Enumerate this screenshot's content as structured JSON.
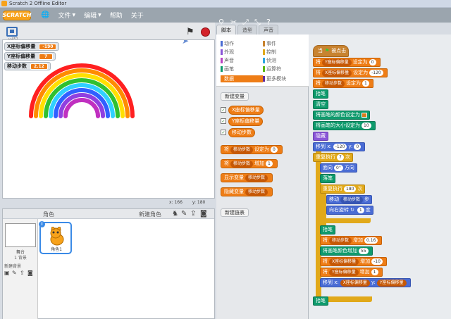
{
  "window": {
    "title": "Scratch 2 Offline Editor"
  },
  "menubar": {
    "logo": "SCRATCH",
    "items": [
      "文件",
      "编辑",
      "帮助",
      "关于"
    ]
  },
  "stage": {
    "monitors": [
      {
        "label": "X座标偏移量",
        "value": "-190"
      },
      {
        "label": "Y座标偏移量",
        "value": "7"
      },
      {
        "label": "移动步数",
        "value": "2.12"
      }
    ],
    "version": "v.452",
    "coords": {
      "x": "x: 166",
      "y": "y: 180"
    },
    "rainbow_colors": [
      "#ff2020",
      "#ff8c00",
      "#ffe000",
      "#30c030",
      "#30d0ff",
      "#3060ff",
      "#9040e0",
      "#c030c0"
    ]
  },
  "sprites": {
    "label": "角色",
    "new_sprite_label": "新建角色",
    "stage_name": "舞台",
    "stage_bg_count": "1 背景",
    "new_bg_label": "新建背景",
    "sprite_name": "角色1"
  },
  "tabs": [
    "脚本",
    "造型",
    "声音"
  ],
  "categories": [
    {
      "label": "动作",
      "color": "#4a6cd4"
    },
    {
      "label": "事件",
      "color": "#c88330"
    },
    {
      "label": "外观",
      "color": "#8a55d7"
    },
    {
      "label": "控制",
      "color": "#e1a91a"
    },
    {
      "label": "声音",
      "color": "#bb42c3"
    },
    {
      "label": "侦测",
      "color": "#2ca5e2"
    },
    {
      "label": "画笔",
      "color": "#0e9a6c"
    },
    {
      "label": "运算符",
      "color": "#5cb712"
    },
    {
      "label": "数据",
      "color": "#ee7d16"
    },
    {
      "label": "更多模块",
      "color": "#632d99"
    }
  ],
  "palette": {
    "new_var": "新建变量",
    "vars": [
      "X座标偏移量",
      "Y座标偏移量",
      "移动步数"
    ],
    "set_block": {
      "pre": "将",
      "var": "移动步数",
      "mid": "设定为",
      "val": "0"
    },
    "change_block": {
      "pre": "将",
      "var": "移动步数",
      "mid": "增加",
      "val": "1"
    },
    "show_block": {
      "pre": "显示变量",
      "var": "移动步数"
    },
    "hide_block": {
      "pre": "隐藏变量",
      "var": "移动步数"
    },
    "new_list": "新建链表"
  },
  "script": {
    "hat": {
      "pre": "当",
      "post": "被点击"
    },
    "set1": {
      "pre": "将",
      "var": "Y座标偏移量",
      "mid": "设定为",
      "val": "0"
    },
    "set2": {
      "pre": "将",
      "var": "X座标偏移量",
      "mid": "设定为",
      "val": "-120"
    },
    "set3": {
      "pre": "将",
      "var": "移动步数",
      "mid": "设定为",
      "val": "1"
    },
    "pen_up": "抬笔",
    "clear": "清空",
    "pen_color": "将画笔的颜色设定为",
    "pen_size": {
      "pre": "将画笔的大小设定为",
      "val": "10"
    },
    "hide": "隐藏",
    "goto": {
      "pre": "移到 x:",
      "x": "-120",
      "y_label": "y:",
      "y": "0"
    },
    "repeat7": {
      "pre": "重复执行",
      "val": "7",
      "post": "次"
    },
    "point": {
      "pre": "面向",
      "val": "0°",
      "post": "方向"
    },
    "pen_down": "落笔",
    "repeat180": {
      "pre": "重复执行",
      "val": "180",
      "post": "次"
    },
    "move": {
      "pre": "移动",
      "var": "移动步数",
      "post": "步"
    },
    "turn": {
      "pre": "向右旋转",
      "val": "1",
      "post": "度"
    },
    "pen_up2": "抬笔",
    "change_steps": {
      "pre": "将",
      "var": "移动步数",
      "mid": "增加",
      "val": "0.16"
    },
    "change_color": {
      "pre": "将画笔颜色增加",
      "val": "55"
    },
    "change_x": {
      "pre": "将",
      "var": "X座标偏移量",
      "mid": "增加",
      "val": "-10"
    },
    "change_y": {
      "pre": "将",
      "var": "Y座标偏移量",
      "mid": "增加",
      "val": "1"
    },
    "goto2": {
      "pre": "移到 x:",
      "x": "X座标偏移量",
      "y_label": "y:",
      "y": "Y座标偏移量"
    },
    "pen_up3": "抬笔"
  }
}
